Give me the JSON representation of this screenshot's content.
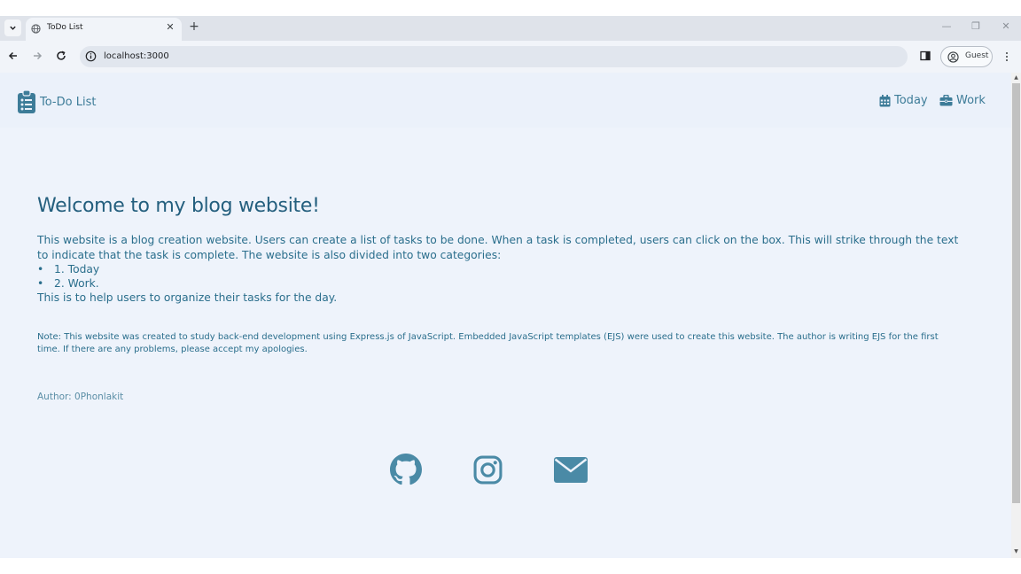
{
  "browser": {
    "tab_title": "ToDo List",
    "tab_close": "✕",
    "new_tab": "+",
    "url": "localhost:3000",
    "profile_label": "Guest",
    "window_controls": {
      "minimize": "—",
      "restore": "❐",
      "close": "✕"
    }
  },
  "site_nav": {
    "brand": "To-Do List",
    "links": [
      {
        "label": "Today",
        "icon": "calendar-icon"
      },
      {
        "label": "Work",
        "icon": "briefcase-icon"
      }
    ]
  },
  "content": {
    "headline": "Welcome to my blog website!",
    "intro": "This website is a blog creation website. Users can create a list of tasks to be done. When a task is completed, users can click on the box. This will strike through the text to indicate that the task is complete. The website is also divided into two categories:",
    "categories": [
      "1. Today",
      "2. Work."
    ],
    "outro": "This is to help users to organize their tasks for the day.",
    "note": "Note: This website was created to study back-end development using Express.js of JavaScript. Embedded JavaScript templates (EJS) were used to create this website. The author is writing EJS for the first time. If there are any problems, please accept my apologies.",
    "author": "Author: 0Phonlakit"
  },
  "socials": [
    "github-icon",
    "instagram-icon",
    "mail-icon"
  ],
  "colors": {
    "accent": "#3d7c98",
    "page_bg": "#eef3fb",
    "icon_social": "#4a8aa6"
  }
}
